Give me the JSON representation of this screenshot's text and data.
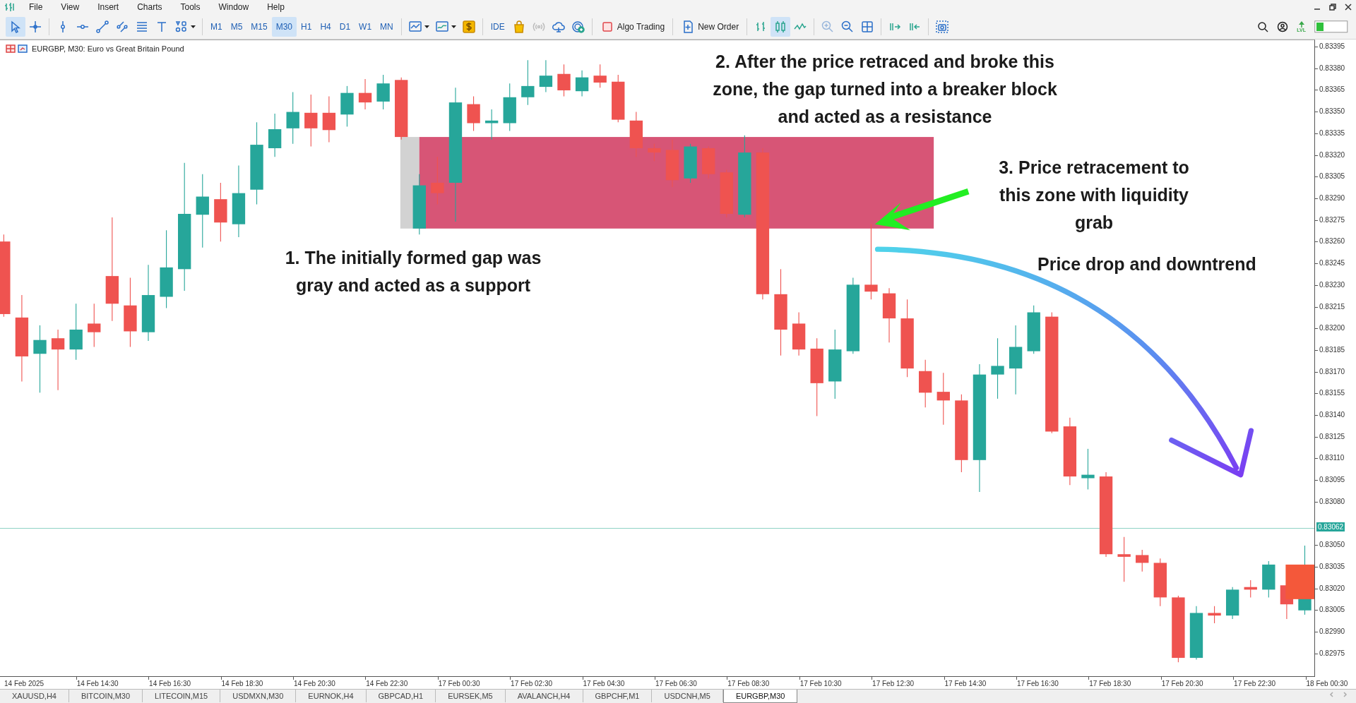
{
  "menu": [
    {
      "label": "File"
    },
    {
      "label": "View"
    },
    {
      "label": "Insert"
    },
    {
      "label": "Charts"
    },
    {
      "label": "Tools"
    },
    {
      "label": "Window"
    },
    {
      "label": "Help"
    }
  ],
  "toolbar": {
    "tools": [
      {
        "kind": "cursor",
        "selected": true
      },
      {
        "kind": "crosshair",
        "selected": false
      }
    ],
    "timeframes": [
      {
        "label": "M1",
        "selected": false
      },
      {
        "label": "M5",
        "selected": false
      },
      {
        "label": "M15",
        "selected": false
      },
      {
        "label": "M30",
        "selected": true
      },
      {
        "label": "H1",
        "selected": false
      },
      {
        "label": "H4",
        "selected": false
      },
      {
        "label": "D1",
        "selected": false
      },
      {
        "label": "W1",
        "selected": false
      },
      {
        "label": "MN",
        "selected": false
      }
    ],
    "ide_label": "IDE",
    "algo_trading_label": "Algo Trading",
    "new_order_label": "New Order",
    "chart_types": [
      {
        "kind": "bars",
        "selected": false
      },
      {
        "kind": "candles",
        "selected": true
      },
      {
        "kind": "line",
        "selected": false
      }
    ],
    "signal_label": "LVL"
  },
  "chart": {
    "title": "EURGBP, M30: Euro vs Great Britain Pound",
    "price_labels": [
      "0.83395",
      "0.83380",
      "0.83365",
      "0.83350",
      "0.83335",
      "0.83320",
      "0.83305",
      "0.83290",
      "0.83275",
      "0.83260",
      "0.83245",
      "0.83230",
      "0.83215",
      "0.83200",
      "0.83185",
      "0.83170",
      "0.83155",
      "0.83140",
      "0.83125",
      "0.83110",
      "0.83095",
      "0.83080",
      "0.83050",
      "0.83035",
      "0.83020",
      "0.83005",
      "0.82990",
      "0.82975"
    ],
    "current_price": "0.83062",
    "time_labels": [
      "14 Feb 2025",
      "14 Feb 14:30",
      "14 Feb 16:30",
      "14 Feb 18:30",
      "14 Feb 20:30",
      "14 Feb 22:30",
      "17 Feb 00:30",
      "17 Feb 02:30",
      "17 Feb 04:30",
      "17 Feb 06:30",
      "17 Feb 08:30",
      "17 Feb 10:30",
      "17 Feb 12:30",
      "17 Feb 14:30",
      "17 Feb 16:30",
      "17 Feb 18:30",
      "17 Feb 20:30",
      "17 Feb 22:30",
      "18 Feb 00:30"
    ],
    "annotations": [
      {
        "lines": [
          "2. After the price retraced and broke this",
          "zone, the gap turned into a breaker block",
          "and acted as a resistance"
        ]
      },
      {
        "lines": [
          "3. Price retracement to",
          "this zone with liquidity",
          "grab"
        ]
      },
      {
        "lines": [
          "1. The initially formed gap was",
          "gray and acted as a support"
        ]
      },
      {
        "lines": [
          "Price drop and downtrend"
        ]
      }
    ]
  },
  "tabs": [
    {
      "label": "XAUUSD,H4",
      "selected": false
    },
    {
      "label": "BITCOIN,M30",
      "selected": false
    },
    {
      "label": "LITECOIN,M15",
      "selected": false
    },
    {
      "label": "USDMXN,M30",
      "selected": false
    },
    {
      "label": "EURNOK,H4",
      "selected": false
    },
    {
      "label": "GBPCAD,H1",
      "selected": false
    },
    {
      "label": "EURSEK,M5",
      "selected": false
    },
    {
      "label": "AVALANCH,H4",
      "selected": false
    },
    {
      "label": "GBPCHF,M1",
      "selected": false
    },
    {
      "label": "USDCNH,M5",
      "selected": false
    },
    {
      "label": "EURGBP,M30",
      "selected": true
    }
  ]
}
